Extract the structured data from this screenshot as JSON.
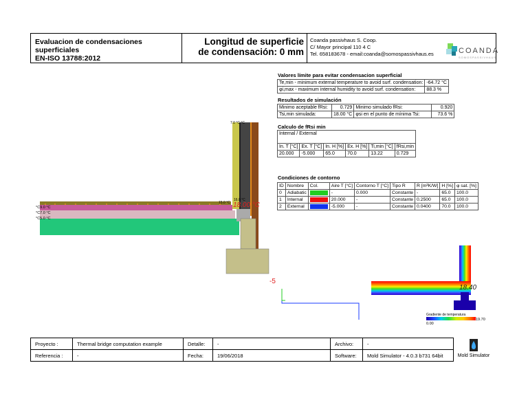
{
  "header": {
    "title_line1": "Evaluacion de condensaciones superficiales",
    "title_line2": "EN-ISO 13788:2012",
    "subtitle_line1": "Longitud de superficie",
    "subtitle_line2": "de condensación: 0 mm",
    "company": "Coanda passivhaus S. Coop.",
    "address": "C/ Mayor principal 110 4 C",
    "contact": "Tel. 658183678  - email:coanda@somospassivhaus.es",
    "logo_text": "COANDA",
    "logo_sub": "SOMOSPASSIVHAUS"
  },
  "limits": {
    "title": "Valores límite para evitar condensacion superficial",
    "row1_label": "Te,min - minimum external temperature to avoid surf. condensation:",
    "row1_value": "-64.72 °C",
    "row2_label": "φi,max - maximum internal humidity to avoid surf. condensation:",
    "row2_value": "88.3 %"
  },
  "results": {
    "title": "Resultados de simulación",
    "r1c1": "Minimo aceptable fRsi:",
    "r1c2": "0.729",
    "r1c3": "Minimo simulado fRsi:",
    "r1c4": "0.920",
    "r2c1": "Tsi,min simulada:",
    "r2c2": "18.00 °C",
    "r2c3": "φsi en el punto de mínima Tsi:",
    "r2c4": "73.6 %"
  },
  "frsi": {
    "title": "Calculo de fRsi min",
    "subtitle": "Internal / External",
    "headers": [
      "In. T [°C]",
      "Ex. T [°C]",
      "In. H [%]",
      "Ex. H [%]",
      "Ti,min [°C]",
      "fRsi,min"
    ],
    "values": [
      "20.000",
      "-5.000",
      "65.0",
      "70.0",
      "13.22",
      "0.729"
    ]
  },
  "boundary": {
    "title": "Condiciones de contorno",
    "headers": [
      "ID",
      "Nombre",
      "Col.",
      "Aire T [°C]",
      "Contorno T [°C]",
      "Tipo R",
      "R [m²K/W]",
      "H [%]",
      "φ sat. [%]"
    ],
    "rows": [
      {
        "id": "0",
        "name": "Adiabatic",
        "color": "#22cc22",
        "air": "-",
        "contour": "0.000",
        "type": "Constante",
        "r": "-",
        "h": "65.0",
        "phi": "100.0"
      },
      {
        "id": "1",
        "name": "Internal",
        "color": "#ee1111",
        "air": "20.000",
        "contour": "-",
        "type": "Constante",
        "r": "0.2500",
        "h": "65.0",
        "phi": "100.0"
      },
      {
        "id": "2",
        "name": "External",
        "color": "#1133ee",
        "air": "-5.000",
        "contour": "-",
        "type": "Constante",
        "r": "0.0400",
        "h": "70.0",
        "phi": "100.0"
      }
    ]
  },
  "drawing": {
    "min_temp_label": "18.00  °C",
    "ext_label": "-5",
    "top_labels": "7.0  °C  °C",
    "iso_label_1": "°C9.0 °C",
    "iso_label_2": "°C7.0 °C",
    "iso_label_3": "°C5.0 °C",
    "iso_label_4": "15.0 °C",
    "iso_label_5": "16.0 °C"
  },
  "thermal": {
    "max_label": "18.40",
    "legend_title": "Gradiente de temperatura",
    "legend_min": "0.00",
    "legend_max": "19.70"
  },
  "footer": {
    "proyecto_label": "Proyecto :",
    "proyecto_value": "Thermal bridge computation example",
    "detalle_label": "Detalle:",
    "detalle_value": "-",
    "archivo_label": "Archivo:",
    "archivo_value": "-",
    "referencia_label": "Referencia :",
    "referencia_value": "-",
    "fecha_label": "Fecha:",
    "fecha_value": "19/06/2018",
    "software_label": "Software:",
    "software_value": "Mold Simulator - 4.0.3 b731 64bit",
    "brand": "Mold Simulator"
  }
}
